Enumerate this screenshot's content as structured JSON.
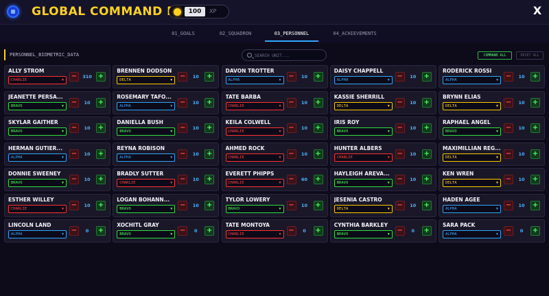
{
  "header": {
    "title": "GLOBAL COMMAND DECK",
    "xp_value": "100",
    "xp_label": "XP",
    "close_label": "X"
  },
  "tabs": [
    {
      "label": "01_GOALS",
      "active": false
    },
    {
      "label": "02_SQUADRON",
      "active": false
    },
    {
      "label": "03_PERSONNEL",
      "active": true
    },
    {
      "label": "04_ACHIEVEMENTS",
      "active": false
    }
  ],
  "toolbar": {
    "section_label": "PERSONNEL_BIOMETRIC_DATA",
    "search_placeholder": "SEARCH UNIT...",
    "command_all": "COMMAND ALL",
    "reset_all": "RESET ALL"
  },
  "squad_colors": {
    "ALPHA": "#39aaff",
    "BRAVO": "#4dff5a",
    "CHARLIE": "#ff4545",
    "DELTA": "#ffd21e"
  },
  "personnel": [
    {
      "name": "ALLY STROM",
      "squad": "CHARLIE",
      "count": "310"
    },
    {
      "name": "BRENNEN DODSON",
      "squad": "DELTA",
      "count": "10"
    },
    {
      "name": "DAVON TROTTER",
      "squad": "ALPHA",
      "count": "10"
    },
    {
      "name": "DAISY CHAPPELL",
      "squad": "ALPHA",
      "count": "10"
    },
    {
      "name": "RODERICK ROSSI",
      "squad": "ALPHA",
      "count": "10"
    },
    {
      "name": "JEANETTE PERSA...",
      "squad": "BRAVO",
      "count": "10"
    },
    {
      "name": "ROSEMARY TAFO...",
      "squad": "ALPHA",
      "count": "10"
    },
    {
      "name": "TATE BARBA",
      "squad": "CHARLIE",
      "count": "10"
    },
    {
      "name": "KASSIE SHERRILL",
      "squad": "DELTA",
      "count": "10"
    },
    {
      "name": "BRYNN ELIAS",
      "squad": "DELTA",
      "count": "10"
    },
    {
      "name": "SKYLAR GAITHER",
      "squad": "BRAVO",
      "count": "10"
    },
    {
      "name": "DANIELLA BUSH",
      "squad": "BRAVO",
      "count": "10"
    },
    {
      "name": "KEILA COLWELL",
      "squad": "CHARLIE",
      "count": "10"
    },
    {
      "name": "IRIS ROY",
      "squad": "BRAVO",
      "count": "10"
    },
    {
      "name": "RAPHAEL ANGEL",
      "squad": "BRAVO",
      "count": "10"
    },
    {
      "name": "HERMAN GUTIER...",
      "squad": "ALPHA",
      "count": "10"
    },
    {
      "name": "REYNA ROBISON",
      "squad": "ALPHA",
      "count": "10"
    },
    {
      "name": "AHMED ROCK",
      "squad": "CHARLIE",
      "count": "10"
    },
    {
      "name": "HUNTER ALBERS",
      "squad": "CHARLIE",
      "count": "10"
    },
    {
      "name": "MAXIMILLIAN REG...",
      "squad": "DELTA",
      "count": "10"
    },
    {
      "name": "DONNIE SWEENEY",
      "squad": "BRAVO",
      "count": "10"
    },
    {
      "name": "BRADLY SUTTER",
      "squad": "CHARLIE",
      "count": "10"
    },
    {
      "name": "EVERETT PHIPPS",
      "squad": "CHARLIE",
      "count": "60"
    },
    {
      "name": "HAYLEIGH AREVA...",
      "squad": "BRAVO",
      "count": "10"
    },
    {
      "name": "KEN WREN",
      "squad": "DELTA",
      "count": "10"
    },
    {
      "name": "ESTHER WILLEY",
      "squad": "CHARLIE",
      "count": "10"
    },
    {
      "name": "LOGAN BOHANN...",
      "squad": "BRAVO",
      "count": "10"
    },
    {
      "name": "TYLOR LOWERY",
      "squad": "BRAVO",
      "count": "10"
    },
    {
      "name": "JESENIA CASTRO",
      "squad": "DELTA",
      "count": "10"
    },
    {
      "name": "HADEN AGEE",
      "squad": "ALPHA",
      "count": "10"
    },
    {
      "name": "LINCOLN LAND",
      "squad": "ALPHA",
      "count": "0"
    },
    {
      "name": "XOCHITL GRAY",
      "squad": "BRAVO",
      "count": "0"
    },
    {
      "name": "TATE MONTOYA",
      "squad": "CHARLIE",
      "count": "0"
    },
    {
      "name": "CYNTHIA BARKLEY",
      "squad": "BRAVO",
      "count": "0"
    },
    {
      "name": "SARA PACK",
      "squad": "ALPHA",
      "count": "0"
    }
  ]
}
